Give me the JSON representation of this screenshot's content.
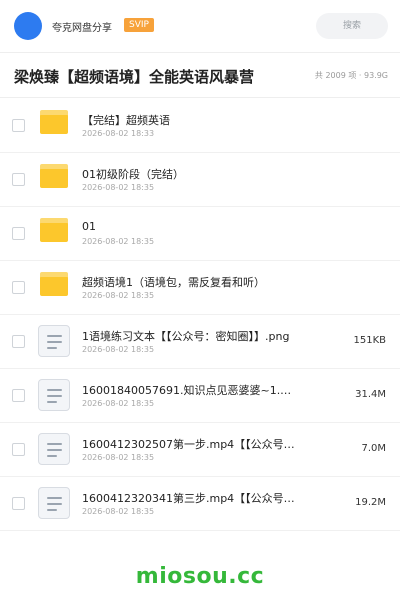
{
  "header": {
    "app_name": "夸克网盘分享",
    "badge": "SVIP",
    "search_placeholder": "搜索"
  },
  "share": {
    "title": "梁焕臻【超频语境】全能英语风暴营",
    "meta": "共 2009 项 · 93.9G"
  },
  "files": [
    {
      "type": "folder",
      "name": "【完结】超频英语",
      "date": "2026-08-02 18:33",
      "size": ""
    },
    {
      "type": "folder",
      "name": "01初级阶段（完结）",
      "date": "2026-08-02 18:35",
      "size": ""
    },
    {
      "type": "folder",
      "name": "01",
      "date": "2026-08-02 18:35",
      "size": ""
    },
    {
      "type": "folder",
      "name": "超频语境1（语境包，需反复看和听）",
      "date": "2026-08-02 18:35",
      "size": ""
    },
    {
      "type": "file",
      "name": "1语境练习文本【【公众号：密知圈】】.png",
      "date": "2026-08-02 18:35",
      "size": "151KB"
    },
    {
      "type": "file",
      "name": "16001840057691.知识点见恶婆婆~1.…",
      "date": "2026-08-02 18:35",
      "size": "31.4M"
    },
    {
      "type": "file",
      "name": "1600412302507第一步.mp4【【公众号…",
      "date": "2026-08-02 18:35",
      "size": "7.0M"
    },
    {
      "type": "file",
      "name": "1600412320341第三步.mp4【【公众号…",
      "date": "2026-08-02 18:35",
      "size": "19.2M"
    }
  ],
  "watermark": "miosou.cc"
}
